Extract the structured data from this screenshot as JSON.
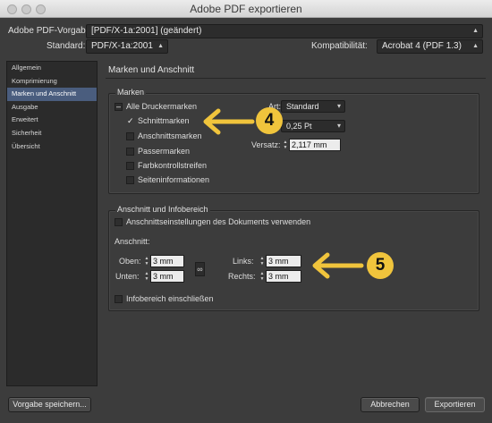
{
  "window": {
    "title": "Adobe PDF exportieren"
  },
  "header": {
    "preset_label": "Adobe PDF-Vorgabe:",
    "preset_value": "[PDF/X-1a:2001] (geändert)",
    "standard_label": "Standard:",
    "standard_value": "PDF/X-1a:2001",
    "compat_label": "Kompatibilität:",
    "compat_value": "Acrobat 4 (PDF 1.3)"
  },
  "sidebar": {
    "items": [
      {
        "label": "Allgemein"
      },
      {
        "label": "Komprimierung"
      },
      {
        "label": "Marken und Anschnitt"
      },
      {
        "label": "Ausgabe"
      },
      {
        "label": "Erweitert"
      },
      {
        "label": "Sicherheit"
      },
      {
        "label": "Übersicht"
      }
    ],
    "active_index": 2
  },
  "main": {
    "title": "Marken und Anschnitt",
    "marks": {
      "title": "Marken",
      "all_marks": "Alle Druckermarken",
      "crop_marks": "Schnittmarken",
      "bleed_marks": "Anschnittsmarken",
      "registration_marks": "Passermarken",
      "color_bars": "Farbkontrollstreifen",
      "page_info": "Seiteninformationen",
      "type_label": "Art:",
      "type_value": "Standard",
      "weight_label": "S",
      "weight_value": "0,25 Pt",
      "offset_label": "Versatz:",
      "offset_value": "2,117 mm"
    },
    "bleed": {
      "title": "Anschnitt und Infobereich",
      "use_doc_settings": "Anschnittseinstellungen des Dokuments verwenden",
      "bleed_label": "Anschnitt:",
      "top_label": "Oben:",
      "top_value": "3 mm",
      "bottom_label": "Unten:",
      "bottom_value": "3 mm",
      "left_label": "Links:",
      "left_value": "3 mm",
      "right_label": "Rechts:",
      "right_value": "3 mm",
      "include_slug": "Infobereich einschließen"
    }
  },
  "annotations": {
    "badge_4": "4",
    "badge_5": "5",
    "arrow_color": "#f0c43c"
  },
  "footer": {
    "save_preset": "Vorgabe speichern...",
    "cancel": "Abbrechen",
    "export": "Exportieren"
  }
}
